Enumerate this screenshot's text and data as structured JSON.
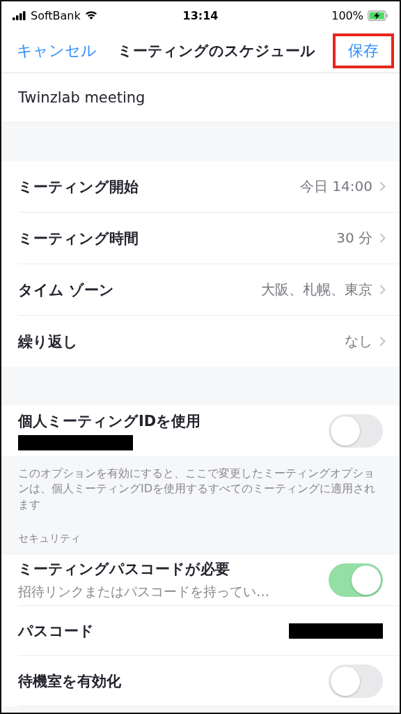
{
  "status_bar": {
    "carrier": "SoftBank",
    "time": "13:14",
    "battery": "100%"
  },
  "nav": {
    "cancel": "キャンセル",
    "title": "ミーティングのスケジュール",
    "save": "保存",
    "save_highlighted": true
  },
  "topic": {
    "value": "Twinzlab meeting"
  },
  "rows": [
    {
      "label": "ミーティング開始",
      "value": "今日 14:00"
    },
    {
      "label": "ミーティング時間",
      "value": "30 分"
    },
    {
      "label": "タイム ゾーン",
      "value": "大阪、札幌、東京"
    },
    {
      "label": "繰り返し",
      "value": "なし"
    }
  ],
  "pmi": {
    "label": "個人ミーティングIDを使用",
    "redacted": true,
    "on": false
  },
  "pmi_note": "このオプションを有効にすると、ここで変更したミーティングオプションは、個人ミーティングIDを使用するすべてのミーティングに適用されます",
  "security": {
    "header": "セキュリティ",
    "items": [
      {
        "kind": "toggle",
        "label": "ミーティングパスコードが必要",
        "subtitle": "招待リンクまたはパスコードを持ってい…",
        "on": true
      },
      {
        "kind": "redacted",
        "label": "パスコード"
      },
      {
        "kind": "toggle",
        "label": "待機室を有効化",
        "on": false
      }
    ]
  }
}
